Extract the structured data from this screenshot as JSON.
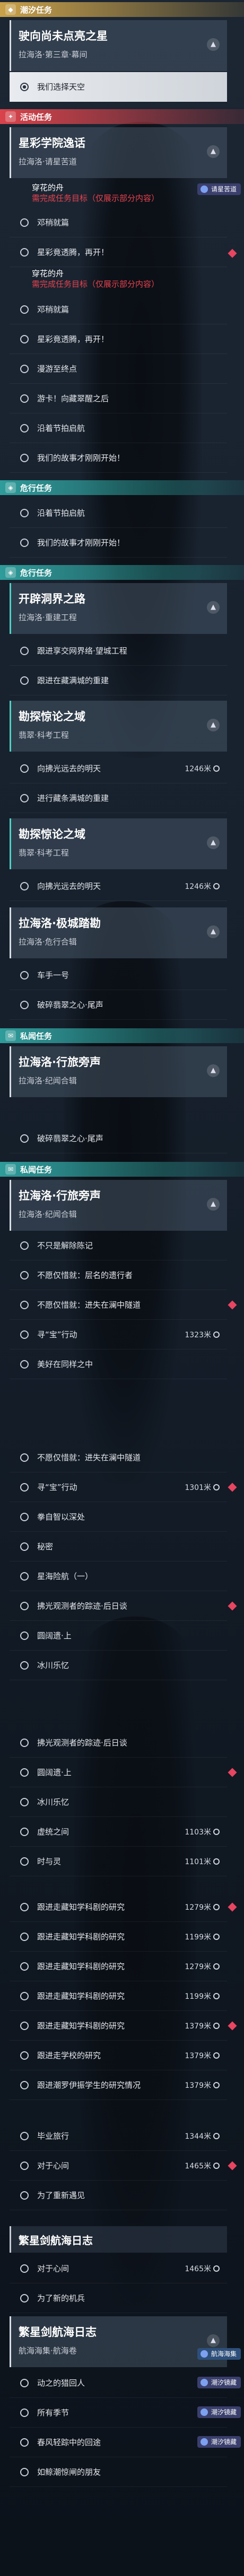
{
  "sections": {
    "chaohsi": "潮汐任务",
    "event": "活动任务",
    "companion1": "危行任务",
    "companion2": "危行任务",
    "main1": "危行任务",
    "reply1": "私闻任务",
    "reply2": "私闻任务"
  },
  "card1": {
    "title": "驶向尚未点亮之星",
    "sub": "拉海洛·第三章·幕间"
  },
  "row_selected": "我们选择天空",
  "card2": {
    "title": "星彩学院逸话",
    "sub": "拉海洛·请星苦道"
  },
  "row_a1": "穿花的舟",
  "note1": {
    "l1": "穿花的舟",
    "l2": "需完成任务目标（仅展示部分内容）"
  },
  "tag_new": "请星苦道",
  "rows_event": [
    "邓稍就篇",
    "星彩竟透腾，再开！",
    "邓稍就篇",
    "星彩竟透腾，再开！",
    "漫游至终点",
    "游卡！向藏翠醒之后",
    "沿着节拍启航",
    "我们的故事才刚刚开始！"
  ],
  "rows_event2": [
    "沿着节拍启航",
    "我们的故事才刚刚开始！"
  ],
  "card3": {
    "title": "开辟洞界之路",
    "sub": "拉海洛·重建工程"
  },
  "rows_c3": [
    "跟进享交网界络·望城工程",
    "跟进在藏满城的重建"
  ],
  "card4": {
    "title": "勘探惊论之域",
    "sub": "翡翠·科考工程"
  },
  "rows_c4": [
    {
      "t": "向拂光远去的明天",
      "r": "1246米"
    },
    {
      "t": "进行藏条满城的重建",
      "r": ""
    }
  ],
  "card5": {
    "title": "勘探惊论之域",
    "sub": "翡翠·科考工程"
  },
  "rows_c5": [
    {
      "t": "向拂光远去的明天",
      "r": "1246米"
    }
  ],
  "card6": {
    "title": "拉海洛·极城踏勘",
    "sub": "拉海洛·危行合辑"
  },
  "rows_c6": [
    "车手一号",
    "破碎翡翠之心·尾声"
  ],
  "card7": {
    "title": "拉海洛·行旅旁声",
    "sub": "拉海洛·纪闻合辑"
  },
  "rows_c7": [
    "破碎翡翠之心·尾声"
  ],
  "card8": {
    "title": "拉海洛·行旅旁声",
    "sub": "拉海洛·纪闻合辑"
  },
  "rows_c8": [
    {
      "t": "不只是解除陈记",
      "r": ""
    },
    {
      "t": "不愿仅惜就：层名的遗行者",
      "r": ""
    },
    {
      "t": "不愿仅惜就：进失在澜中隧道",
      "r": ""
    },
    {
      "t": "寻“宝”行动",
      "r": "1323米"
    },
    {
      "t": "美好在同样之中",
      "r": ""
    },
    {
      "t": "不愿仅惜就：进失在澜中隧道",
      "r": ""
    },
    {
      "t": "寻“宝”行动",
      "r": "1301米"
    },
    {
      "t": "拳自智以深处",
      "r": ""
    },
    {
      "t": "秘密",
      "r": ""
    },
    {
      "t": "星海险航（一）",
      "r": ""
    },
    {
      "t": "拂光观测者的踪迹·后日谈",
      "r": ""
    },
    {
      "t": "圆阔遗·上",
      "r": ""
    },
    {
      "t": "冰川乐忆",
      "r": ""
    },
    {
      "t": "拂光观测者的踪迹·后日谈",
      "r": ""
    },
    {
      "t": "圆阔遗·上",
      "r": ""
    },
    {
      "t": "冰川乐忆",
      "r": ""
    },
    {
      "t": "虚统之间",
      "r": "1103米"
    },
    {
      "t": "时与灵",
      "r": "1101米"
    },
    {
      "t": "跟进走藏知学科剧的研究",
      "r": "1279米"
    },
    {
      "t": "跟进走藏知学科剧的研究",
      "r": "1199米"
    },
    {
      "t": "跟进走藏知学科剧的研究",
      "r": "1279米"
    },
    {
      "t": "跟进走藏知学科剧的研究",
      "r": "1199米"
    },
    {
      "t": "跟进走藏知学科剧的研究",
      "r": "1379米"
    },
    {
      "t": "跟进走学校的研究",
      "r": "1379米"
    },
    {
      "t": "跟进潮罗伊振学生的研究情况",
      "r": "1379米"
    },
    {
      "t": "毕业旅行",
      "r": "1344米"
    },
    {
      "t": "对于心间",
      "r": "1465米"
    },
    {
      "t": "为了重新遇见",
      "r": ""
    }
  ],
  "card9": {
    "title": "繁星剑航海日志",
    "sub": ""
  },
  "rows_c9": [
    {
      "t": "对于心间",
      "r": "1465米"
    },
    {
      "t": "为了新的机兵",
      "r": ""
    }
  ],
  "card10": {
    "title": "繁星剑航海日志",
    "sub": "航海海集·航海卷"
  },
  "rows_c10": [
    "动之的猎回人",
    "所有季节",
    "春风轻踪中的回途",
    "如鲸潮惊闸的朋友"
  ],
  "tags_end": [
    "航海海集",
    "潮汐镜藏",
    "潮汐镜藏",
    "潮汐镜藏"
  ]
}
